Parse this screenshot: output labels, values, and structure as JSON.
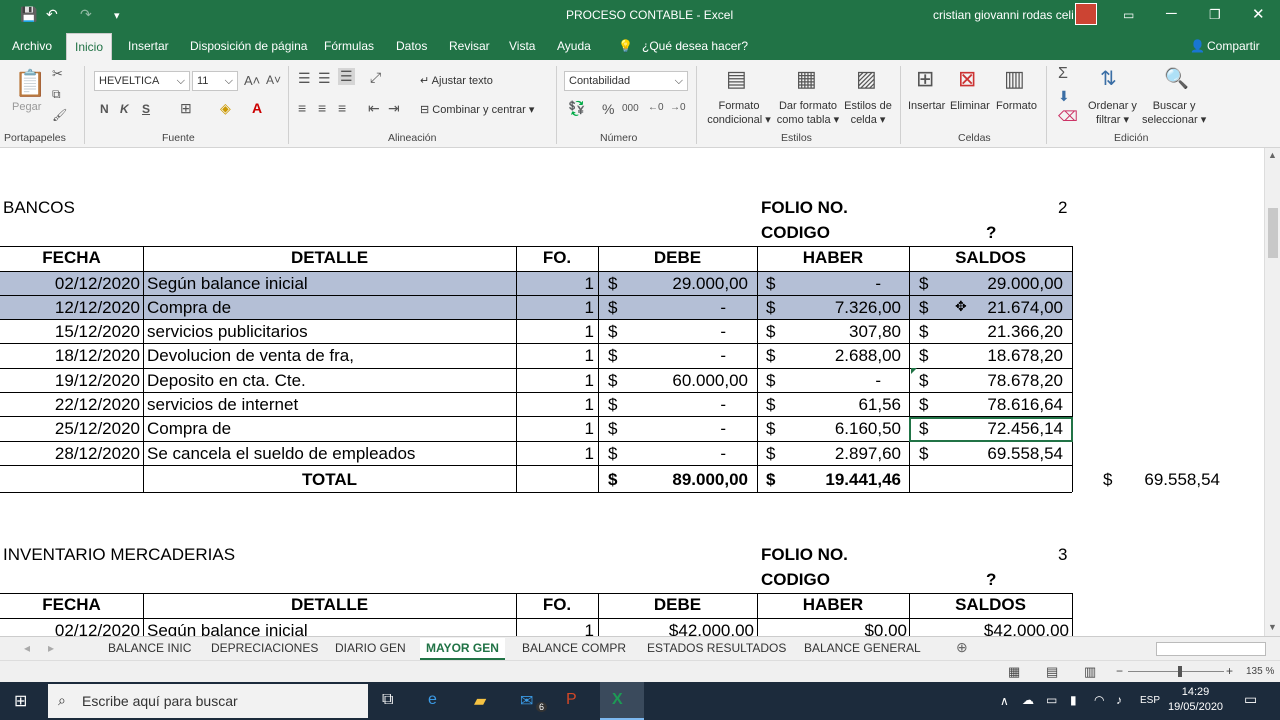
{
  "window": {
    "title": "PROCESO CONTABLE  -  Excel",
    "user": "cristian giovanni rodas celi"
  },
  "menu": [
    "Archivo",
    "Inicio",
    "Insertar",
    "Disposición de página",
    "Fórmulas",
    "Datos",
    "Revisar",
    "Vista",
    "Ayuda",
    "¿Qué desea hacer?",
    "Compartir"
  ],
  "ribbon": {
    "paste": "Pegar",
    "font_name": "HEVELTICA",
    "font_size": "11",
    "bold": "N",
    "italic": "K",
    "underline": "S",
    "wrap_text": "Ajustar texto",
    "merge_center": "Combinar y centrar",
    "number_format": "Contabilidad",
    "percent": "%",
    "thousands": "000",
    "cond_format_1": "Formato",
    "cond_format_2": "condicional",
    "table_format_1": "Dar formato",
    "table_format_2": "como tabla",
    "cell_styles_1": "Estilos de",
    "cell_styles_2": "celda",
    "insert": "Insertar",
    "delete": "Eliminar",
    "format": "Formato",
    "sort_1": "Ordenar y",
    "sort_2": "filtrar",
    "find_1": "Buscar y",
    "find_2": "seleccionar",
    "groups": [
      "Portapapeles",
      "Fuente",
      "Alineación",
      "Número",
      "Estilos",
      "Celdas",
      "Edición"
    ]
  },
  "ledger1": {
    "account": "BANCOS",
    "folio_label": "FOLIO NO.",
    "folio_value": "2",
    "codigo_label": "CODIGO",
    "codigo_value": "?",
    "headers": [
      "FECHA",
      "DETALLE",
      "FO.",
      "DEBE",
      "HABER",
      "SALDOS"
    ],
    "rows": [
      {
        "fecha": "02/12/2020",
        "detalle": "Según balance inicial",
        "fo": "1",
        "debe": "29.000,00",
        "haber": "-",
        "saldo": "29.000,00"
      },
      {
        "fecha": "12/12/2020",
        "detalle": "Compra de",
        "fo": "1",
        "debe": "-",
        "haber": "7.326,00",
        "saldo": "21.674,00"
      },
      {
        "fecha": "15/12/2020",
        "detalle": "servicios publicitarios",
        "fo": "1",
        "debe": "-",
        "haber": "307,80",
        "saldo": "21.366,20"
      },
      {
        "fecha": "18/12/2020",
        "detalle": "Devolucion de venta de fra,",
        "fo": "1",
        "debe": "-",
        "haber": "2.688,00",
        "saldo": "18.678,20"
      },
      {
        "fecha": "19/12/2020",
        "detalle": "Deposito en cta. Cte.",
        "fo": "1",
        "debe": "60.000,00",
        "haber": "-",
        "saldo": "78.678,20"
      },
      {
        "fecha": "22/12/2020",
        "detalle": "servicios de internet",
        "fo": "1",
        "debe": "-",
        "haber": "61,56",
        "saldo": "78.616,64"
      },
      {
        "fecha": "25/12/2020",
        "detalle": "Compra de",
        "fo": "1",
        "debe": "-",
        "haber": "6.160,50",
        "saldo": "72.456,14"
      },
      {
        "fecha": "28/12/2020",
        "detalle": "Se cancela el sueldo de empleados",
        "fo": "1",
        "debe": "-",
        "haber": "2.897,60",
        "saldo": "69.558,54"
      }
    ],
    "total_label": "TOTAL",
    "total_debe": "89.000,00",
    "total_haber": "19.441,46",
    "side_total": "69.558,54",
    "currency": "$"
  },
  "ledger2": {
    "account": "INVENTARIO MERCADERIAS",
    "folio_label": "FOLIO NO.",
    "folio_value": "3",
    "codigo_label": "CODIGO",
    "codigo_value": "?",
    "headers": [
      "FECHA",
      "DETALLE",
      "FO.",
      "DEBE",
      "HABER",
      "SALDOS"
    ],
    "first_row": {
      "fecha": "02/12/2020",
      "detalle": "Según balance inicial",
      "fo": "1",
      "debe": "$42.000,00",
      "haber": "$0,00",
      "saldo": "$42.000,00"
    }
  },
  "sheet_tabs": [
    "BALANCE INIC",
    "DEPRECIACIONES",
    "DIARIO GEN",
    "MAYOR GEN",
    "BALANCE COMPR",
    "ESTADOS RESULTADOS",
    "BALANCE GENERAL"
  ],
  "active_sheet": "MAYOR GEN",
  "zoom": "135 %",
  "taskbar": {
    "search_placeholder": "Escribe aquí para buscar",
    "lang": "ESP",
    "time": "14:29",
    "date": "19/05/2020",
    "mail_badge": "6"
  },
  "colors": {
    "excel_green": "#217346",
    "row_highlight": "#b4bfd6",
    "selection": "#217346"
  }
}
